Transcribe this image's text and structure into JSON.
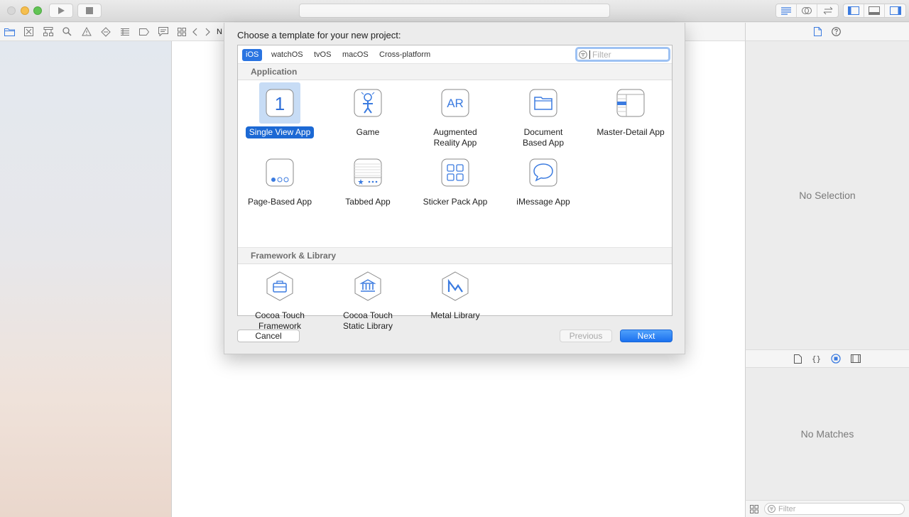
{
  "dialog": {
    "title": "Choose a template for your new project:",
    "platform_tabs": [
      "iOS",
      "watchOS",
      "tvOS",
      "macOS",
      "Cross-platform"
    ],
    "selected_tab": "iOS",
    "filter_placeholder": "Filter",
    "sections": [
      {
        "heading": "Application",
        "templates": [
          {
            "label": "Single View App",
            "icon": "single-view-app-icon",
            "selected": true
          },
          {
            "label": "Game",
            "icon": "game-icon"
          },
          {
            "label": "Augmented\nReality App",
            "icon": "augmented-reality-icon"
          },
          {
            "label": "Document\nBased App",
            "icon": "document-folder-icon"
          },
          {
            "label": "Master-Detail App",
            "icon": "master-detail-icon"
          },
          {
            "label": "Page-Based App",
            "icon": "page-dots-icon"
          },
          {
            "label": "Tabbed App",
            "icon": "tabbed-icon"
          },
          {
            "label": "Sticker Pack App",
            "icon": "sticker-grid-icon"
          },
          {
            "label": "iMessage App",
            "icon": "message-bubble-icon"
          }
        ]
      },
      {
        "heading": "Framework & Library",
        "templates": [
          {
            "label": "Cocoa Touch\nFramework",
            "icon": "toolbox-hexagon-icon"
          },
          {
            "label": "Cocoa Touch\nStatic Library",
            "icon": "library-hexagon-icon"
          },
          {
            "label": "Metal Library",
            "icon": "metal-hexagon-icon"
          }
        ]
      }
    ],
    "icon_texts": {
      "single_view": "1",
      "ar": "AR"
    },
    "buttons": {
      "cancel": "Cancel",
      "previous": "Previous",
      "next": "Next"
    }
  },
  "editor": {
    "breadcrumb_char": "N"
  },
  "inspector": {
    "no_selection": "No Selection"
  },
  "library": {
    "no_matches": "No Matches",
    "filter_placeholder": "Filter"
  },
  "colors": {
    "accent": "#1c69d4",
    "icon_blue": "#3b7be0"
  }
}
